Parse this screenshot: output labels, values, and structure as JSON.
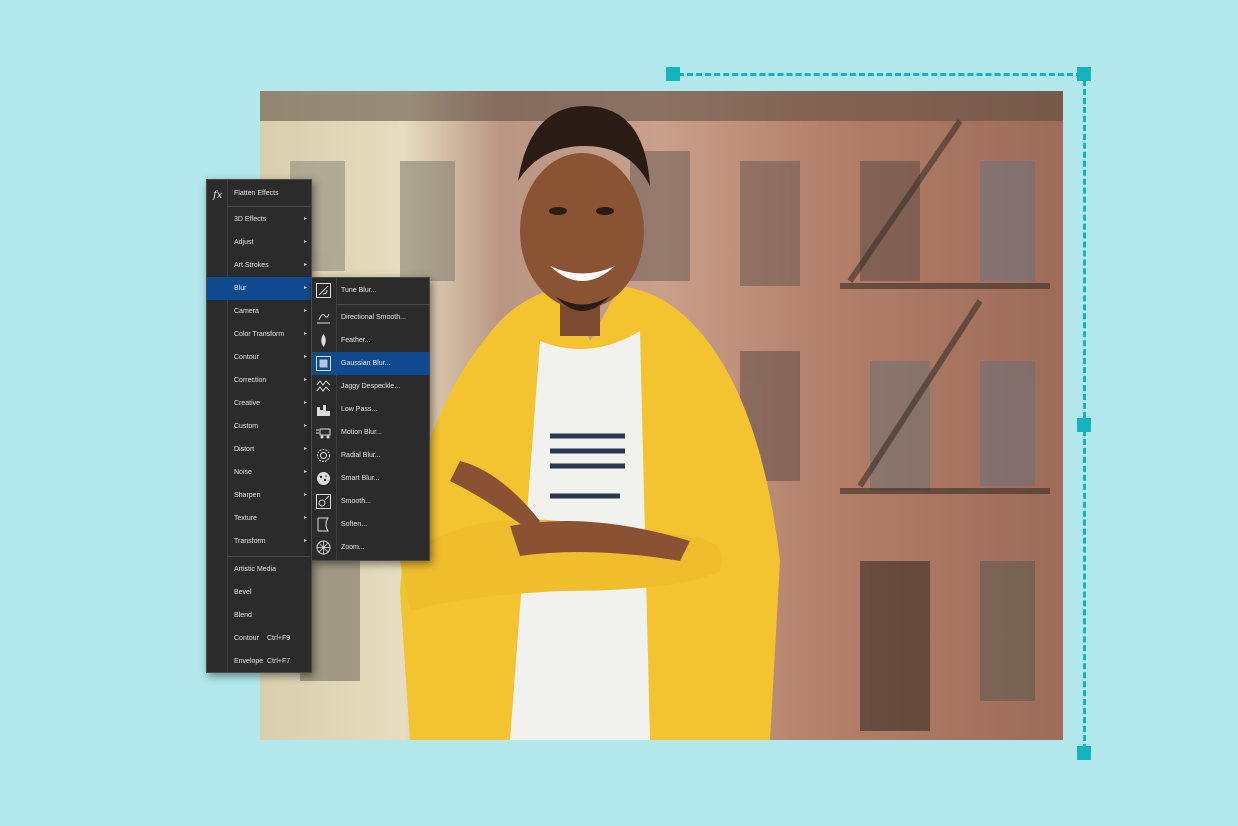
{
  "main_menu": {
    "header": {
      "label": "Flatten Effects",
      "icon": "fx-icon"
    },
    "items": [
      {
        "label": "3D Effects",
        "submenu": true
      },
      {
        "label": "Adjust",
        "submenu": true
      },
      {
        "label": "Art Strokes",
        "submenu": true
      },
      {
        "label": "Blur",
        "submenu": true,
        "active": true
      },
      {
        "label": "Camera",
        "submenu": true
      },
      {
        "label": "Color Transform",
        "submenu": true
      },
      {
        "label": "Contour",
        "submenu": true
      },
      {
        "label": "Correction",
        "submenu": true
      },
      {
        "label": "Creative",
        "submenu": true
      },
      {
        "label": "Custom",
        "submenu": true
      },
      {
        "label": "Distort",
        "submenu": true
      },
      {
        "label": "Noise",
        "submenu": true
      },
      {
        "label": "Sharpen",
        "submenu": true
      },
      {
        "label": "Texture",
        "submenu": true
      },
      {
        "label": "Transform",
        "submenu": true
      }
    ],
    "extra_items": [
      {
        "label": "Artistic Media",
        "shortcut": ""
      },
      {
        "label": "Bevel",
        "shortcut": ""
      },
      {
        "label": "Blend",
        "shortcut": ""
      },
      {
        "label": "Contour",
        "shortcut": "Ctrl+F9"
      },
      {
        "label": "Envelope",
        "shortcut": "Ctrl+F7"
      }
    ],
    "arrow": "▸"
  },
  "blur_submenu": {
    "items": [
      {
        "label": "Tune Blur...",
        "icon": "tune-blur-icon"
      },
      {
        "label": "Directional Smooth...",
        "icon": "directional-smooth-icon"
      },
      {
        "label": "Feather...",
        "icon": "feather-icon"
      },
      {
        "label": "Gaussian Blur...",
        "icon": "gaussian-blur-icon",
        "active": true
      },
      {
        "label": "Jaggy Despeckle...",
        "icon": "jaggy-despeckle-icon"
      },
      {
        "label": "Low Pass...",
        "icon": "low-pass-icon"
      },
      {
        "label": "Motion Blur...",
        "icon": "motion-blur-icon"
      },
      {
        "label": "Radial Blur...",
        "icon": "radial-blur-icon"
      },
      {
        "label": "Smart Blur...",
        "icon": "smart-blur-icon"
      },
      {
        "label": "Smooth...",
        "icon": "smooth-icon"
      },
      {
        "label": "Soften...",
        "icon": "soften-icon"
      },
      {
        "label": "Zoom...",
        "icon": "zoom-blur-icon"
      }
    ]
  },
  "colors": {
    "background": "#b2e8ec",
    "accent": "#13b4bd",
    "menu_bg": "#2b2b2b",
    "highlight": "#0f4a90"
  }
}
